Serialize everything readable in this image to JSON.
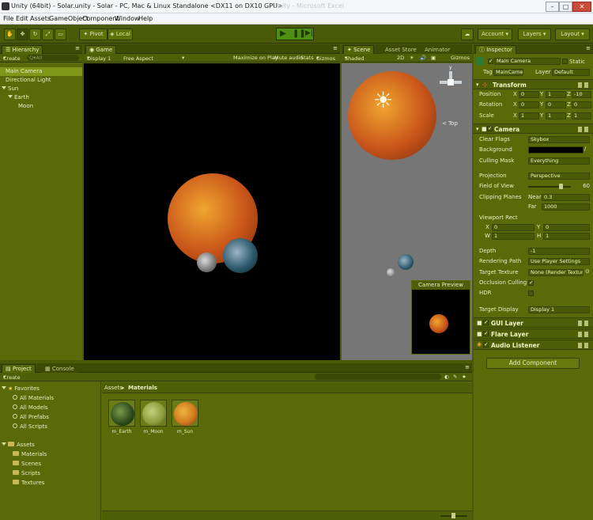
{
  "window": {
    "title": "Unity (64bit) - Solar.unity - Solar - PC, Mac & Linux Standalone <DX11 on DX10 GPU>",
    "title_ghost": "Unity - Microsoft Excel",
    "min": "–",
    "max": "□",
    "close": "✕"
  },
  "menu": [
    "File",
    "Edit",
    "Assets",
    "GameObject",
    "Component",
    "Window",
    "Help"
  ],
  "toolbar": {
    "pivot": "Pivot",
    "local": "Local",
    "account": "Account",
    "layers": "Layers",
    "layout": "Layout"
  },
  "hierarchy": {
    "tab": "Hierarchy",
    "create": "Create",
    "search": "Q▾All",
    "items": [
      {
        "label": "Main Camera",
        "indent": 0,
        "selected": true
      },
      {
        "label": "Directional Light",
        "indent": 0
      },
      {
        "label": "Sun",
        "indent": 0,
        "expanded": true
      },
      {
        "label": "Earth",
        "indent": 1,
        "expanded": true
      },
      {
        "label": "Moon",
        "indent": 2
      }
    ]
  },
  "game": {
    "tab": "Game",
    "display": "Display 1",
    "aspect": "Free Aspect",
    "maximize": "Maximize on Play",
    "mute": "Mute audio",
    "stats": "Stats",
    "gizmos": "Gizmos"
  },
  "scene": {
    "tabs": [
      "Scene",
      "Asset Store",
      "Animator"
    ],
    "shaded": "Shaded",
    "twod": "2D",
    "gizmos": "Gizmos",
    "top": "< Top",
    "axis_y": "y",
    "preview_title": "Camera Preview"
  },
  "inspector": {
    "tab": "Inspector",
    "object_name": "Main Camera",
    "static": "Static",
    "tag_label": "Tag",
    "tag": "MainCamera",
    "layer_label": "Layer",
    "layer": "Default",
    "transform": {
      "title": "Transform",
      "rows": [
        {
          "label": "Position",
          "x": "0",
          "y": "1",
          "z": "-10"
        },
        {
          "label": "Rotation",
          "x": "0",
          "y": "0",
          "z": "0"
        },
        {
          "label": "Scale",
          "x": "1",
          "y": "1",
          "z": "1"
        }
      ]
    },
    "camera": {
      "title": "Camera",
      "clear_flags_label": "Clear Flags",
      "clear_flags": "Skybox",
      "background_label": "Background",
      "culling_label": "Culling Mask",
      "culling": "Everything",
      "projection_label": "Projection",
      "projection": "Perspective",
      "fov_label": "Field of View",
      "fov": "60",
      "clip_label": "Clipping Planes",
      "near_label": "Near",
      "near": "0.3",
      "far_label": "Far",
      "far": "1000",
      "viewport_label": "Viewport Rect",
      "vx": "0",
      "vy": "0",
      "vw": "1",
      "vh": "1",
      "depth_label": "Depth",
      "depth": "-1",
      "rendering_label": "Rendering Path",
      "rendering": "Use Player Settings",
      "target_texture_label": "Target Texture",
      "target_texture": "None (Render Texture)",
      "occlusion_label": "Occlusion Culling",
      "hdr_label": "HDR",
      "target_display_label": "Target Display",
      "target_display": "Display 1"
    },
    "components": [
      "GUI Layer",
      "Flare Layer",
      "Audio Listener"
    ],
    "add_component": "Add Component"
  },
  "project": {
    "tabs": [
      "Project",
      "Console"
    ],
    "create": "Create",
    "breadcrumb_root": "Assets",
    "breadcrumb_sep": "▸",
    "breadcrumb_leaf": "Materials",
    "favorites_title": "Favorites",
    "favorites": [
      "All Materials",
      "All Models",
      "All Prefabs",
      "All Scripts"
    ],
    "assets_title": "Assets",
    "folders": [
      "Materials",
      "Scenes",
      "Scripts",
      "Textures"
    ],
    "materials": [
      {
        "name": "m_Earth",
        "color": "#2c4a1c"
      },
      {
        "name": "m_Moon",
        "color": "#8a9a3a"
      },
      {
        "name": "m_Sun",
        "color": "#d07a1c"
      }
    ]
  }
}
